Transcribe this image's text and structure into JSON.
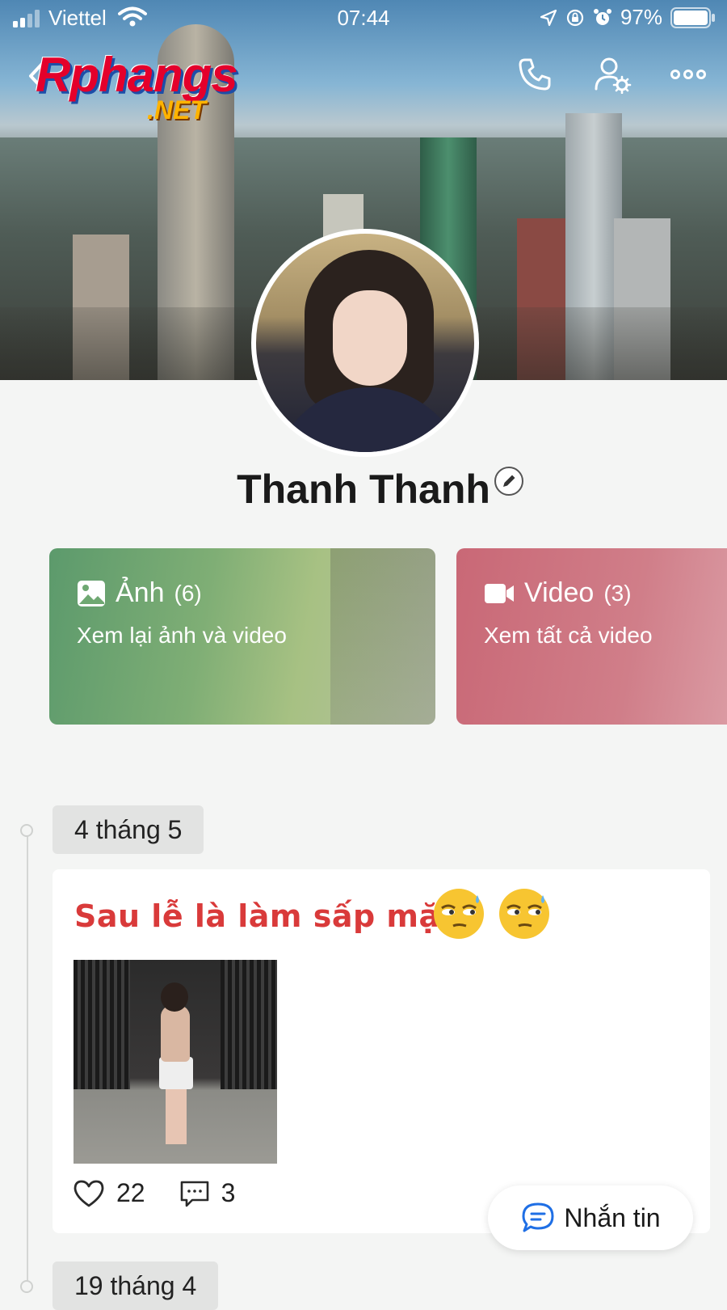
{
  "status_bar": {
    "carrier": "Viettel",
    "time": "07:44",
    "battery": "97%",
    "battery_level": 0.97
  },
  "header": {
    "logo_text": "Rphangs",
    "logo_suffix": ".NET",
    "icons": [
      "back-arrow-icon",
      "phone-icon",
      "user-settings-icon",
      "more-icon"
    ]
  },
  "profile": {
    "name": "Thanh Thanh"
  },
  "media": {
    "photo": {
      "label": "Ảnh",
      "count": "(6)",
      "subtitle": "Xem lại ảnh và video"
    },
    "video": {
      "label": "Video",
      "count": "(3)",
      "subtitle": "Xem tất cả video"
    }
  },
  "timeline": [
    {
      "date": "4 tháng 5",
      "text": "Sau lễ là làm sấp mặt",
      "likes": "22",
      "comments": "3"
    },
    {
      "date": "19 tháng 4"
    }
  ],
  "chat_button": {
    "label": "Nhắn tin"
  },
  "colors": {
    "post_text": "#d93a3a",
    "photo_card": "#6fa872",
    "video_card": "#cd7380",
    "background": "#f4f5f4"
  }
}
